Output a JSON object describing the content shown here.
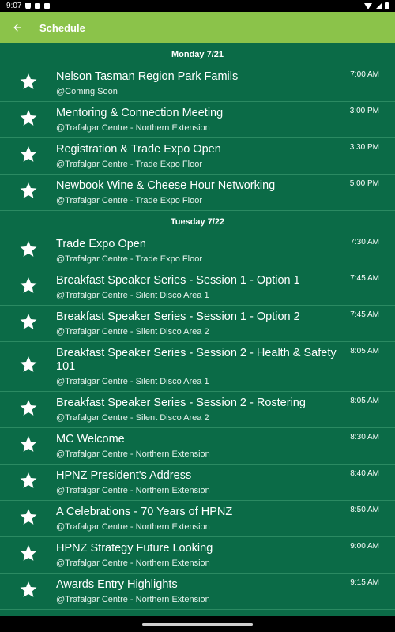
{
  "status_bar": {
    "time": "9:07",
    "icons": [
      "shield-icon",
      "sd-card-icon",
      "notification-icon",
      "wifi-icon",
      "signal-icon",
      "battery-icon"
    ]
  },
  "app_bar": {
    "back_icon": "arrow-back-icon",
    "title": "Schedule",
    "background_color": "#8bc34a"
  },
  "colors": {
    "background": "#0b6b47",
    "divider": "#2b8a62",
    "text": "#ffffff"
  },
  "days": [
    {
      "label": "Monday 7/21",
      "events": [
        {
          "title": "Nelson Tasman Region Park Famils",
          "location": "@Coming Soon",
          "time": "7:00 AM"
        },
        {
          "title": "Mentoring & Connection Meeting",
          "location": "@Trafalgar Centre - Northern Extension",
          "time": "3:00 PM"
        },
        {
          "title": "Registration & Trade Expo Open",
          "location": "@Trafalgar Centre - Trade Expo Floor",
          "time": "3:30 PM"
        },
        {
          "title": "Newbook Wine & Cheese Hour Networking",
          "location": "@Trafalgar Centre - Trade Expo Floor",
          "time": "5:00 PM"
        }
      ]
    },
    {
      "label": "Tuesday 7/22",
      "events": [
        {
          "title": "Trade Expo Open",
          "location": "@Trafalgar Centre - Trade Expo Floor",
          "time": "7:30 AM"
        },
        {
          "title": "Breakfast Speaker Series - Session 1 - Option 1",
          "location": "@Trafalgar Centre - Silent Disco Area 1",
          "time": "7:45 AM"
        },
        {
          "title": "Breakfast Speaker Series - Session 1 - Option 2",
          "location": "@Trafalgar Centre - Silent Disco Area 2",
          "time": "7:45 AM"
        },
        {
          "title": "Breakfast Speaker Series - Session 2 - Health & Safety 101",
          "location": "@Trafalgar Centre - Silent Disco Area 1",
          "time": "8:05 AM"
        },
        {
          "title": "Breakfast Speaker Series - Session 2 - Rostering",
          "location": "@Trafalgar Centre - Silent Disco Area 2",
          "time": "8:05 AM"
        },
        {
          "title": "MC Welcome",
          "location": "@Trafalgar Centre - Northern Extension",
          "time": "8:30 AM"
        },
        {
          "title": "HPNZ President's Address",
          "location": "@Trafalgar Centre - Northern Extension",
          "time": "8:40 AM"
        },
        {
          "title": "A Celebrations - 70 Years of HPNZ",
          "location": "@Trafalgar Centre - Northern Extension",
          "time": "8:50 AM"
        },
        {
          "title": "HPNZ Strategy Future Looking",
          "location": "@Trafalgar Centre - Northern Extension",
          "time": "9:00 AM"
        },
        {
          "title": "Awards Entry Highlights",
          "location": "@Trafalgar Centre - Northern Extension",
          "time": "9:15 AM"
        }
      ]
    }
  ]
}
